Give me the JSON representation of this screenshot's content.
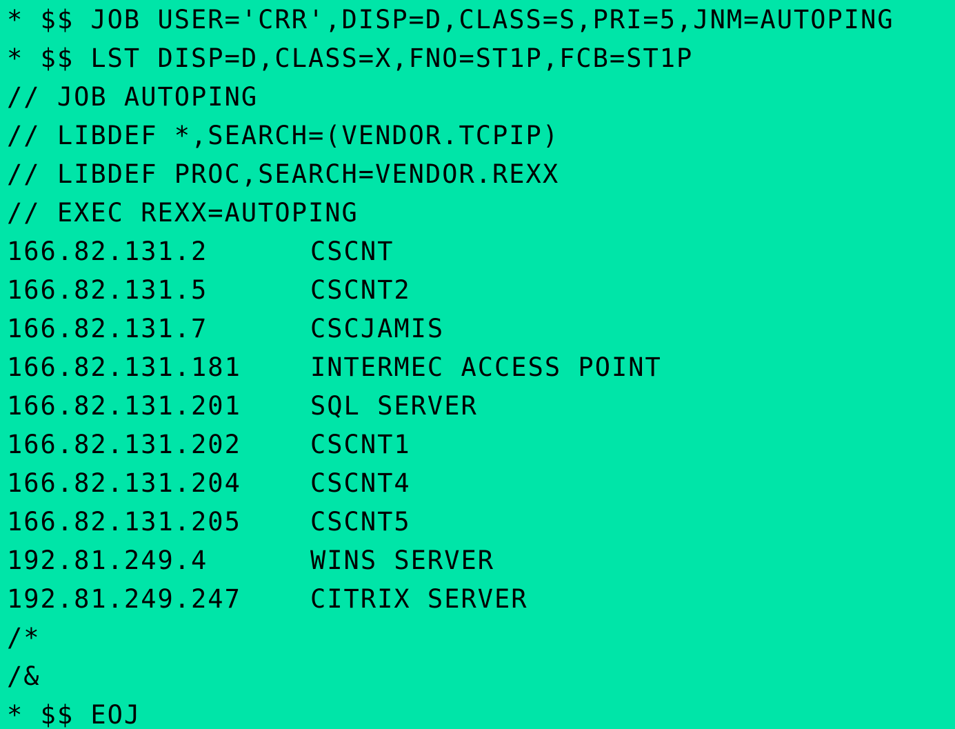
{
  "jcl_header": [
    "* $$ JOB USER='CRR',DISP=D,CLASS=S,PRI=5,JNM=AUTOPING",
    "* $$ LST DISP=D,CLASS=X,FNO=ST1P,FCB=ST1P",
    "// JOB AUTOPING",
    "// LIBDEF *,SEARCH=(VENDOR.TCPIP)",
    "// LIBDEF PROC,SEARCH=VENDOR.REXX",
    "// EXEC REXX=AUTOPING"
  ],
  "hosts": [
    {
      "ip": "166.82.131.2",
      "name": "CSCNT"
    },
    {
      "ip": "166.82.131.5",
      "name": "CSCNT2"
    },
    {
      "ip": "166.82.131.7",
      "name": "CSCJAMIS"
    },
    {
      "ip": "166.82.131.181",
      "name": "INTERMEC ACCESS POINT"
    },
    {
      "ip": "166.82.131.201",
      "name": "SQL SERVER"
    },
    {
      "ip": "166.82.131.202",
      "name": "CSCNT1"
    },
    {
      "ip": "166.82.131.204",
      "name": "CSCNT4"
    },
    {
      "ip": "166.82.131.205",
      "name": "CSCNT5"
    },
    {
      "ip": "192.81.249.4",
      "name": "WINS SERVER"
    },
    {
      "ip": "192.81.249.247",
      "name": "CITRIX SERVER"
    }
  ],
  "jcl_footer": [
    "/*",
    "/&",
    "* $$ EOJ"
  ],
  "colors": {
    "background": "#00E5A8",
    "text": "#000000"
  }
}
